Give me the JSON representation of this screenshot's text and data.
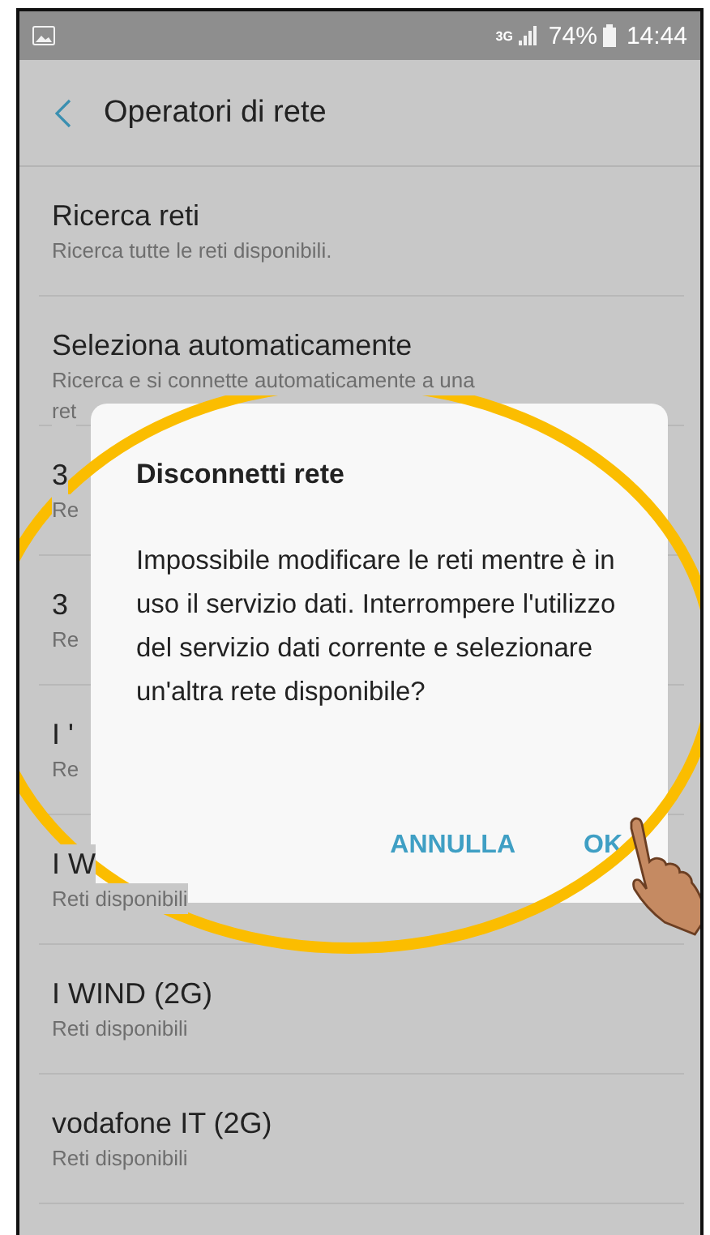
{
  "status_bar": {
    "network": "3G",
    "battery": "74%",
    "time": "14:44"
  },
  "header": {
    "title": "Operatori di rete"
  },
  "rows": [
    {
      "title": "Ricerca reti",
      "subtitle": "Ricerca tutte le reti disponibili."
    },
    {
      "title": "Seleziona automaticamente",
      "subtitle": "Ricerca e si connette automaticamente a una",
      "subtitle_cont": "ret"
    },
    {
      "title": "3",
      "subtitle": "Re"
    },
    {
      "title": "3",
      "subtitle": "Re"
    },
    {
      "title": "I '",
      "subtitle": "Re"
    },
    {
      "title": "I W",
      "subtitle": "Reti disponibili"
    },
    {
      "title": "I WIND (2G)",
      "subtitle": "Reti disponibili"
    },
    {
      "title": "vodafone IT (2G)",
      "subtitle": "Reti disponibili"
    }
  ],
  "dialog": {
    "title": "Disconnetti rete",
    "message": "Impossibile modificare le reti mentre è in uso il servizio dati. Interrompere l'utilizzo del servizio dati corrente e selezionare un'altra rete disponibile?",
    "buttons": [
      "ANNULLA",
      "OK"
    ]
  }
}
